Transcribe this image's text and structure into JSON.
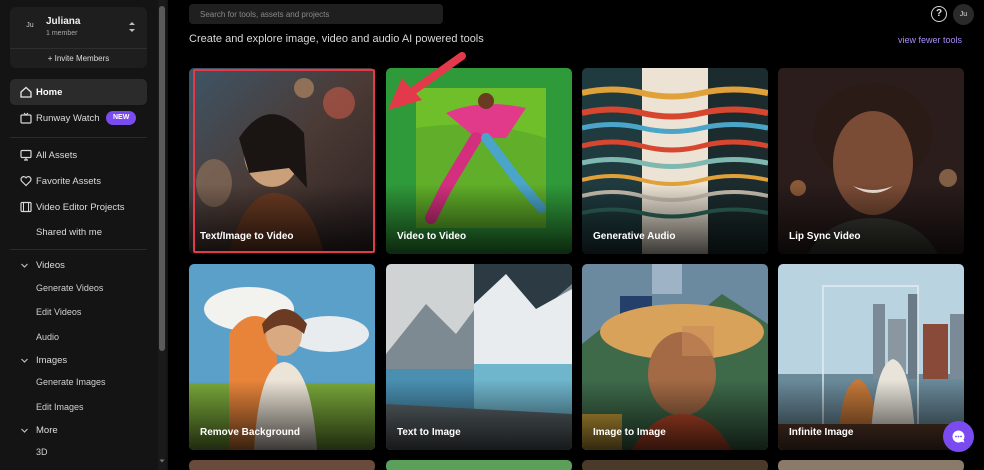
{
  "workspace": {
    "avatar_initials": "Ju",
    "name": "Juliana",
    "members": "1 member",
    "invite_label": "+ Invite Members"
  },
  "nav": {
    "home": "Home",
    "runway_watch": "Runway Watch",
    "new_badge": "NEW",
    "all_assets": "All Assets",
    "favorite_assets": "Favorite Assets",
    "video_editor_projects": "Video Editor Projects",
    "shared_with_me": "Shared with me"
  },
  "sections": {
    "videos": {
      "label": "Videos",
      "items": [
        "Generate Videos",
        "Edit Videos",
        "Audio"
      ]
    },
    "images": {
      "label": "Images",
      "items": [
        "Generate Images",
        "Edit Images"
      ]
    },
    "more": {
      "label": "More",
      "items": [
        "3D"
      ]
    }
  },
  "header": {
    "search_placeholder": "Search for tools, assets and projects",
    "help_icon": "?",
    "user_initials": "Ju",
    "headline": "Create and explore image, video and audio AI powered tools",
    "view_fewer": "view fewer tools"
  },
  "tools": [
    "Text/Image to Video",
    "Video to Video",
    "Generative Audio",
    "Lip Sync Video",
    "Remove Background",
    "Text to Image",
    "Image to Image",
    "Infinite Image"
  ],
  "colors": {
    "accent": "#7a4bf0",
    "highlight": "#e23a4a",
    "link": "#a98cf5"
  }
}
